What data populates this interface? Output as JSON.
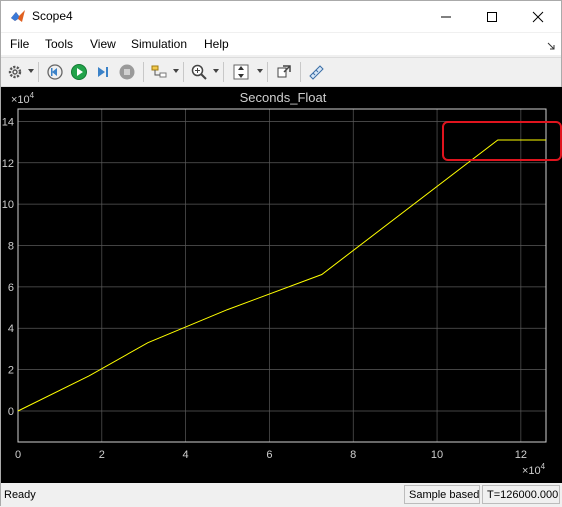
{
  "window": {
    "title": "Scope4"
  },
  "menu": {
    "items": [
      "File",
      "Tools",
      "View",
      "Simulation",
      "Help"
    ]
  },
  "toolbar": {
    "icons": [
      "settings-icon",
      "step-back-icon",
      "run-icon",
      "step-forward-icon",
      "stop-icon",
      "signal-selector-icon",
      "zoom-icon",
      "autoscale-icon",
      "highlight-simulink-block-icon",
      "measurements-icon"
    ]
  },
  "plot": {
    "title": "Seconds_Float",
    "x_exponent_base": "×10",
    "x_exponent_power": "4",
    "y_exponent_base": "×10",
    "y_exponent_power": "4",
    "line_color": "#ffff00",
    "background_color": "#000000",
    "grid_color": "#5a5a5a"
  },
  "chart_data": {
    "type": "line",
    "title": "Seconds_Float",
    "xlabel": "",
    "ylabel": "",
    "x_tick_labels": [
      "0",
      "2",
      "4",
      "6",
      "8",
      "10",
      "12"
    ],
    "y_tick_labels": [
      "0",
      "2",
      "4",
      "6",
      "8",
      "10",
      "12",
      "14"
    ],
    "x_ticks": [
      0,
      2,
      4,
      6,
      8,
      10,
      12
    ],
    "y_ticks": [
      0,
      2,
      4,
      6,
      8,
      10,
      12,
      14
    ],
    "xlim": [
      0,
      12.6
    ],
    "ylim": [
      -1.5,
      14.6
    ],
    "x_scale_note": "x10^4",
    "y_scale_note": "x10^4",
    "grid": true,
    "series": [
      {
        "x": [
          0,
          1.7,
          3.1,
          5.0,
          7.25,
          11.45,
          12.6
        ],
        "y": [
          0,
          1.7,
          3.3,
          4.9,
          6.6,
          13.1,
          13.1
        ]
      }
    ]
  },
  "status": {
    "left": "Ready",
    "mode": "Sample based",
    "time": "T=126000.000"
  },
  "annotation_color": "#e0141e"
}
